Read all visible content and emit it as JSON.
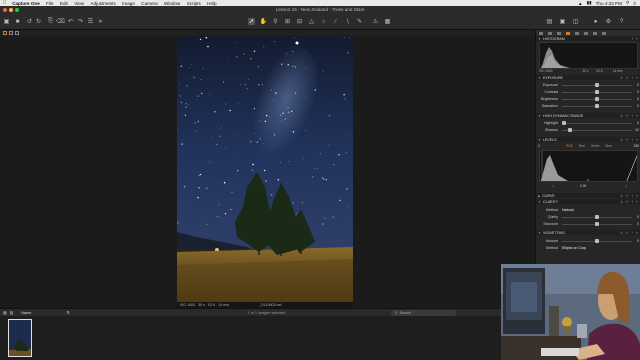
{
  "menubar": {
    "app": "Capture One",
    "items": [
      "File",
      "Edit",
      "View",
      "Adjustments",
      "Image",
      "Camera",
      "Window",
      "Scripts",
      "Help"
    ],
    "clock": "Thu 4:33 PM"
  },
  "window": {
    "title": "Lesson 15 - New Zealand - Trees and Stars"
  },
  "viewer": {
    "view_modes": [
      "100",
      "87",
      "60"
    ],
    "caption": {
      "iso": "ISO 1600",
      "shutter": "30 s",
      "aperture": "f/2.8",
      "focal": "14 mm",
      "filename": "_DL10603.nef"
    }
  },
  "panel": {
    "histogram": {
      "title": "HISTOGRAM",
      "iso": "ISO 1600",
      "shutter": "30 s",
      "aperture": "f/2.8",
      "focal": "14 mm"
    },
    "exposure": {
      "title": "EXPOSURE",
      "rows": [
        {
          "label": "Exposure",
          "value": "0"
        },
        {
          "label": "Contrast",
          "value": "0"
        },
        {
          "label": "Brightness",
          "value": "0"
        },
        {
          "label": "Saturation",
          "value": "0"
        }
      ]
    },
    "hdr": {
      "title": "HIGH DYNAMIC RANGE",
      "rows": [
        {
          "label": "Highlight",
          "value": "0"
        },
        {
          "label": "Shadow",
          "value": "10"
        }
      ]
    },
    "levels": {
      "title": "LEVELS",
      "low": "0",
      "high": "255",
      "channels": [
        "RGB",
        "Red",
        "Green",
        "Blue"
      ],
      "mid": "0.00"
    },
    "curve": {
      "title": "CURVE"
    },
    "clarity": {
      "title": "CLARITY",
      "method_label": "Method",
      "method_value": "Natural",
      "rows": [
        {
          "label": "Clarity",
          "value": "0"
        },
        {
          "label": "Structure",
          "value": "0"
        }
      ]
    },
    "vignetting": {
      "title": "VIGNETTING",
      "rows": [
        {
          "label": "Amount",
          "value": "0"
        }
      ],
      "method_label": "Method",
      "method_value": "Elliptic on Crop"
    }
  },
  "browser": {
    "sort_label": "Name",
    "status": "1 of 1 images selected",
    "search_placeholder": "Search"
  },
  "colors": {
    "accent": "#d37b2c",
    "panel_bg": "#262626",
    "viewer_bg": "#1b1b1b",
    "sky_top": "#141d33",
    "sky_mid": "#2a3f70"
  },
  "icons": [
    "apple-icon",
    "wifi-icon",
    "battery-icon",
    "search-icon",
    "list-icon",
    "cursor-icon",
    "crop-icon",
    "rotate-icon",
    "picker-icon",
    "settings-icon"
  ]
}
